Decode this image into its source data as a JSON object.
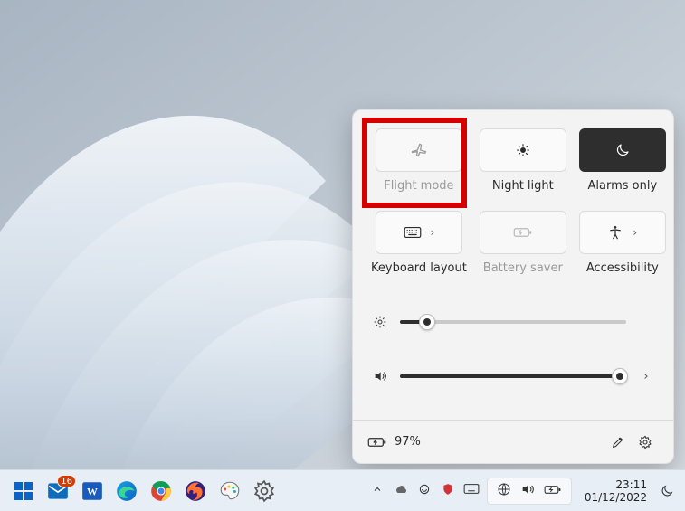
{
  "quick_settings": {
    "tiles": [
      {
        "key": "flight",
        "label": "Flight mode",
        "state": "off",
        "hasArrow": false,
        "highlighted": true
      },
      {
        "key": "night",
        "label": "Night light",
        "state": "off",
        "hasArrow": false
      },
      {
        "key": "alarms",
        "label": "Alarms only",
        "state": "on",
        "hasArrow": false
      },
      {
        "key": "keyboard",
        "label": "Keyboard layout",
        "state": "off",
        "hasArrow": true
      },
      {
        "key": "battery",
        "label": "Battery saver",
        "state": "dim",
        "hasArrow": false,
        "labelDim": true
      },
      {
        "key": "access",
        "label": "Accessibility",
        "state": "off",
        "hasArrow": true
      }
    ],
    "brightness_percent": 12,
    "volume_percent": 97,
    "footer": {
      "battery_text": "97%"
    }
  },
  "taskbar": {
    "mail_badge": "16",
    "clock": {
      "time": "23:11",
      "date": "01/12/2022"
    }
  }
}
